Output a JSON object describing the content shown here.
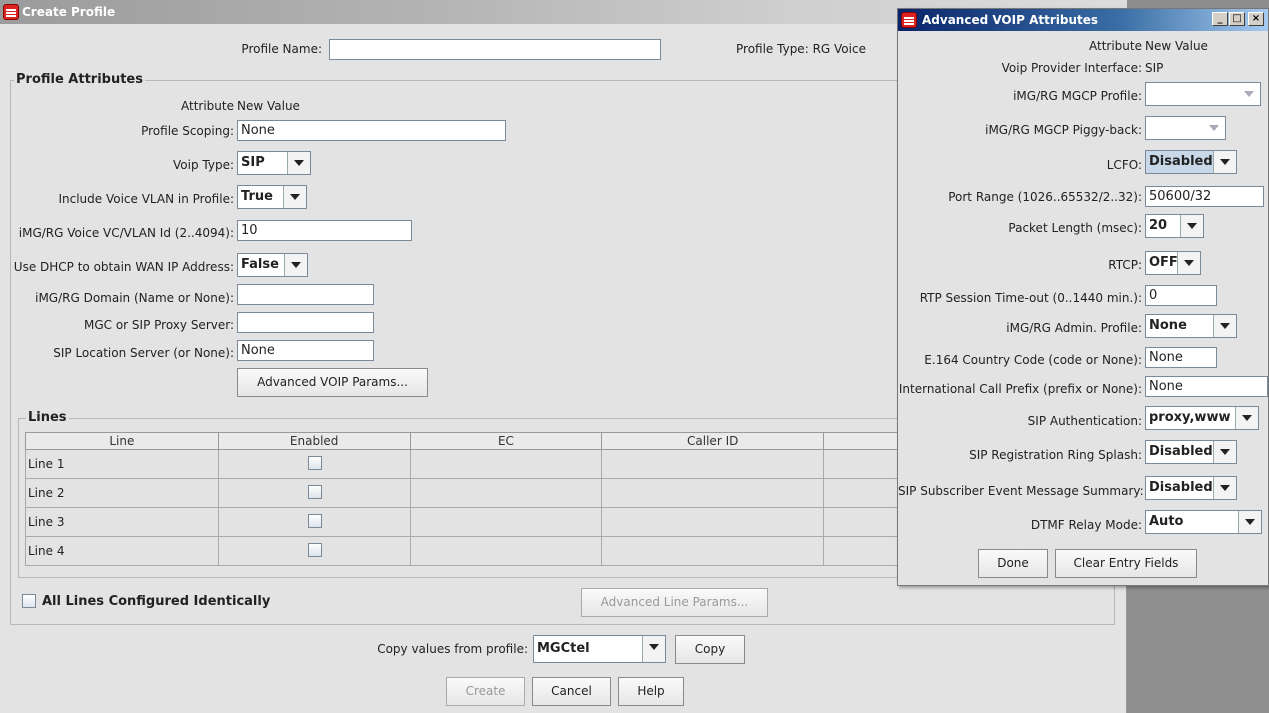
{
  "main_window": {
    "title": "Create Profile",
    "profile_name_label": "Profile Name:",
    "profile_name_value": "",
    "profile_type_label": "Profile Type:",
    "profile_type_value": "RG Voice",
    "attributes_group_title": "Profile Attributes",
    "header_attribute": "Attribute",
    "header_new_value": "New Value",
    "rows": {
      "scoping": {
        "label": "Profile Scoping:",
        "value": "None"
      },
      "voip_type": {
        "label": "Voip Type:",
        "value": "SIP"
      },
      "voice_vlan": {
        "label": "Include Voice VLAN in Profile:",
        "value": "True"
      },
      "vc_vlan_id": {
        "label": "iMG/RG Voice VC/VLAN Id (2..4094):",
        "value": "10"
      },
      "dhcp": {
        "label": "Use DHCP to obtain WAN IP Address:",
        "value": "False"
      },
      "domain": {
        "label": "iMG/RG Domain (Name or None):",
        "value": ""
      },
      "mgc_proxy": {
        "label": "MGC or SIP Proxy Server:",
        "value": ""
      },
      "sip_location": {
        "label": "SIP Location Server (or None):",
        "value": "None"
      }
    },
    "advanced_voip_button": "Advanced VOIP Params...",
    "lines_group_title": "Lines",
    "lines_columns": [
      "Line",
      "Enabled",
      "EC",
      "Caller ID",
      ""
    ],
    "lines_rows": [
      {
        "line": "Line 1"
      },
      {
        "line": "Line 2"
      },
      {
        "line": "Line 3"
      },
      {
        "line": "Line 4"
      }
    ],
    "all_lines_label": "All Lines Configured Identically",
    "advanced_line_button": "Advanced Line Params...",
    "copy_label": "Copy values from profile:",
    "copy_profile_value": "MGCtel",
    "copy_button": "Copy",
    "create_button": "Create",
    "cancel_button": "Cancel",
    "help_button": "Help"
  },
  "advanced_window": {
    "title": "Advanced VOIP Attributes",
    "header_attribute": "Attribute",
    "header_new_value": "New Value",
    "rows": {
      "voip_provider": {
        "label": "Voip Provider Interface:",
        "value": "SIP"
      },
      "mgcp_profile": {
        "label": "iMG/RG MGCP Profile:",
        "value": ""
      },
      "mgcp_piggyback": {
        "label": "iMG/RG MGCP Piggy-back:",
        "value": ""
      },
      "lcfo": {
        "label": "LCFO:",
        "value": "Disabled"
      },
      "port_range": {
        "label": "Port Range (1026..65532/2..32):",
        "value": "50600/32"
      },
      "packet_length": {
        "label": "Packet Length (msec):",
        "value": "20"
      },
      "rtcp": {
        "label": "RTCP:",
        "value": "OFF"
      },
      "rtp_timeout": {
        "label": "RTP Session Time-out (0..1440 min.):",
        "value": "0"
      },
      "admin_profile": {
        "label": "iMG/RG Admin. Profile:",
        "value": "None"
      },
      "country_code": {
        "label": "E.164 Country Code (code or None):",
        "value": "None"
      },
      "intl_prefix": {
        "label": "International Call Prefix (prefix or None):",
        "value": "None"
      },
      "sip_auth": {
        "label": "SIP Authentication:",
        "value": "proxy,www"
      },
      "ring_splash": {
        "label": "SIP Registration Ring Splash:",
        "value": "Disabled"
      },
      "event_summary": {
        "label": "SIP Subscriber Event Message Summary:",
        "value": "Disabled"
      },
      "dtmf": {
        "label": "DTMF Relay Mode:",
        "value": "Auto"
      }
    },
    "done_button": "Done",
    "clear_button": "Clear Entry Fields",
    "minimize_glyph": "_",
    "maximize_glyph": "□",
    "close_glyph": "×"
  }
}
